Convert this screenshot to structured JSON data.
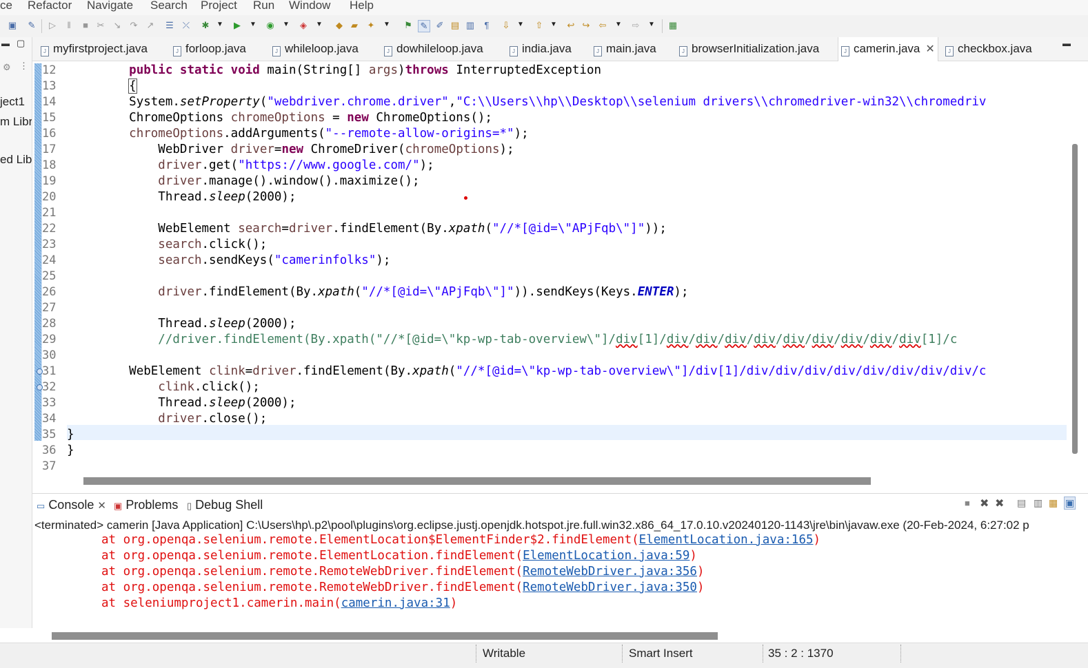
{
  "menu": [
    "ce",
    "Refactor",
    "Navigate",
    "Search",
    "Project",
    "Run",
    "Window",
    "Help"
  ],
  "left_pane": {
    "items": [
      "ject1",
      "m Libr",
      "ed Libr"
    ]
  },
  "tabs": [
    {
      "label": "myfirstproject.java"
    },
    {
      "label": "forloop.java"
    },
    {
      "label": "whileloop.java"
    },
    {
      "label": "dowhileloop.java"
    },
    {
      "label": "india.java"
    },
    {
      "label": "main.java"
    },
    {
      "label": "browserInitialization.java"
    },
    {
      "label": "camerin.java",
      "active": true,
      "close": "✕"
    },
    {
      "label": "checkbox.java"
    }
  ],
  "line_numbers": [
    "12",
    "13",
    "14",
    "15",
    "16",
    "17",
    "18",
    "19",
    "20",
    "21",
    "22",
    "23",
    "24",
    "25",
    "26",
    "27",
    "28",
    "29",
    "30",
    "31",
    "32",
    "33",
    "34",
    "35",
    "36",
    "37"
  ],
  "code": {
    "l12": {
      "kw1": "public static void",
      "mid": " main(String[] ",
      "var": "args",
      "close": ")",
      "kw2": "throws",
      "rest": " InterruptedException"
    },
    "l13": "{",
    "l14": {
      "a": "System.",
      "b": "setProperty",
      "c": "(",
      "s1": "\"webdriver.chrome.driver\"",
      "comma": ",",
      "s2": "\"C:\\\\Users\\\\hp\\\\Desktop\\\\selenium drivers\\\\chromedriver-win32\\\\chromedriv"
    },
    "l15": {
      "a": "ChromeOptions ",
      "v": "chromeOptions",
      "b": " = ",
      "kw": "new",
      "c": " ChromeOptions();"
    },
    "l16": {
      "v": "chromeOptions",
      "a": ".addArguments(",
      "s": "\"--remote-allow-origins=*\"",
      "b": ");"
    },
    "l17": {
      "a": "    WebDriver ",
      "v": "driver",
      "b": "=",
      "kw": "new",
      "c": " ChromeDriver(",
      "v2": "chromeOptions",
      "d": ");"
    },
    "l18": {
      "v": "    driver",
      "a": ".get(",
      "s": "\"https://www.google.com/\"",
      "b": ");"
    },
    "l19": {
      "v": "    driver",
      "a": ".manage().window().maximize();"
    },
    "l20": {
      "a": "    Thread.",
      "b": "sleep",
      "c": "(2000);"
    },
    "l22": {
      "a": "    WebElement ",
      "v": "search",
      "b": "=",
      "v2": "driver",
      "c": ".findElement(By.",
      "d": "xpath",
      "e": "(",
      "s": "\"//*[@id=\\\"APjFqb\\\"]\"",
      "f": "));"
    },
    "l23": {
      "v": "    search",
      "a": ".click();"
    },
    "l24": {
      "v": "    search",
      "a": ".sendKeys(",
      "s": "\"camerinfolks\"",
      "b": ");"
    },
    "l26": {
      "v": "    driver",
      "a": ".findElement(By.",
      "b": "xpath",
      "c": "(",
      "s": "\"//*[@id=\\\"APjFqb\\\"]\"",
      "d": ")).sendKeys(Keys.",
      "cst": "ENTER",
      "e": ");"
    },
    "l28": {
      "a": "    Thread.",
      "b": "sleep",
      "c": "(2000);"
    },
    "l29": {
      "pre": "    //driver.findElement(By.xpath(\"//*[@id=\\\"kp-wp-tab-overview\\\"]/",
      "u1": "div",
      "m1": "[1]/",
      "u2": "div",
      "m2": "/",
      "u3": "div",
      "m3": "/",
      "u4": "div",
      "m4": "/",
      "u5": "div",
      "m5": "/",
      "u6": "div",
      "m6": "/",
      "u7": "div",
      "m7": "/",
      "u8": "div",
      "m8": "/",
      "u9": "div",
      "m9": "/",
      "u10": "div",
      "tail": "[1]/c"
    },
    "l31": {
      "a": "WebElement ",
      "v": "clink",
      "b": "=",
      "v2": "driver",
      "c": ".findElement(By.",
      "d": "xpath",
      "e": "(",
      "s": "\"//*[@id=\\\"kp-wp-tab-overview\\\"]/div[1]/div/div/div/div/div/div/div/div/c"
    },
    "l32": {
      "v": "    clink",
      "a": ".click();"
    },
    "l33": {
      "a": "    Thread.",
      "b": "sleep",
      "c": "(2000);"
    },
    "l34": {
      "v": "    driver",
      "a": ".close();"
    },
    "l35": "}",
    "l36": "}"
  },
  "console": {
    "tabs": [
      "Console",
      "Problems",
      "Debug Shell"
    ],
    "close": "✕",
    "header": "<terminated> camerin [Java Application] C:\\Users\\hp\\.p2\\pool\\plugins\\org.eclipse.justj.openjdk.hotspot.jre.full.win32.x86_64_17.0.10.v20240120-1143\\jre\\bin\\javaw.exe  (20-Feb-2024, 6:27:02 p",
    "lines": [
      {
        "text": "at org.openqa.selenium.remote.ElementLocation$ElementFinder$2.findElement(",
        "link": "ElementLocation.java:165",
        "end": ")"
      },
      {
        "text": "at org.openqa.selenium.remote.ElementLocation.findElement(",
        "link": "ElementLocation.java:59",
        "end": ")"
      },
      {
        "text": "at org.openqa.selenium.remote.RemoteWebDriver.findElement(",
        "link": "RemoteWebDriver.java:356",
        "end": ")"
      },
      {
        "text": "at org.openqa.selenium.remote.RemoteWebDriver.findElement(",
        "link": "RemoteWebDriver.java:350",
        "end": ")"
      },
      {
        "text": "at seleniumproject1.camerin.main(",
        "link": "camerin.java:31",
        "end": ")"
      }
    ]
  },
  "status": {
    "writable": "Writable",
    "insert_mode": "Smart Insert",
    "position": "35 : 2 : 1370"
  },
  "colors": {
    "keyword": "#7f0055",
    "string": "#2a00ff",
    "variable": "#6a3e3e",
    "comment": "#3f7f5f",
    "error": "#e01010",
    "link": "#1a5bb0"
  }
}
